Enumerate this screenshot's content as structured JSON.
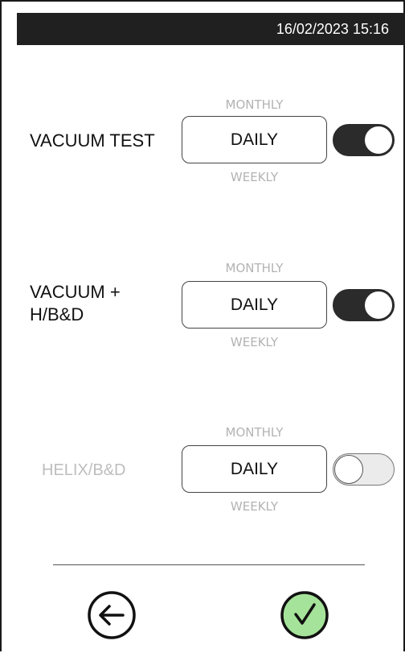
{
  "status_bar": {
    "datetime": "16/02/2023 15:16"
  },
  "rows": [
    {
      "label": "VACUUM TEST",
      "option_above": "MONTHLY",
      "selected": "DAILY",
      "option_below": "WEEKLY",
      "enabled": true
    },
    {
      "label_line1": "VACUUM +",
      "label_line2": "H/B&D",
      "option_above": "MONTHLY",
      "selected": "DAILY",
      "option_below": "WEEKLY",
      "enabled": true
    },
    {
      "label": "HELIX/B&D",
      "option_above": "MONTHLY",
      "selected": "DAILY",
      "option_below": "WEEKLY",
      "enabled": false
    }
  ],
  "footer": {
    "back_icon": "back-arrow-icon",
    "confirm_icon": "checkmark-icon"
  },
  "colors": {
    "dark": "#202020",
    "confirm_fill": "#a6e39a",
    "disabled_text": "#bdbdbd",
    "option_text": "#b3b3b3"
  }
}
